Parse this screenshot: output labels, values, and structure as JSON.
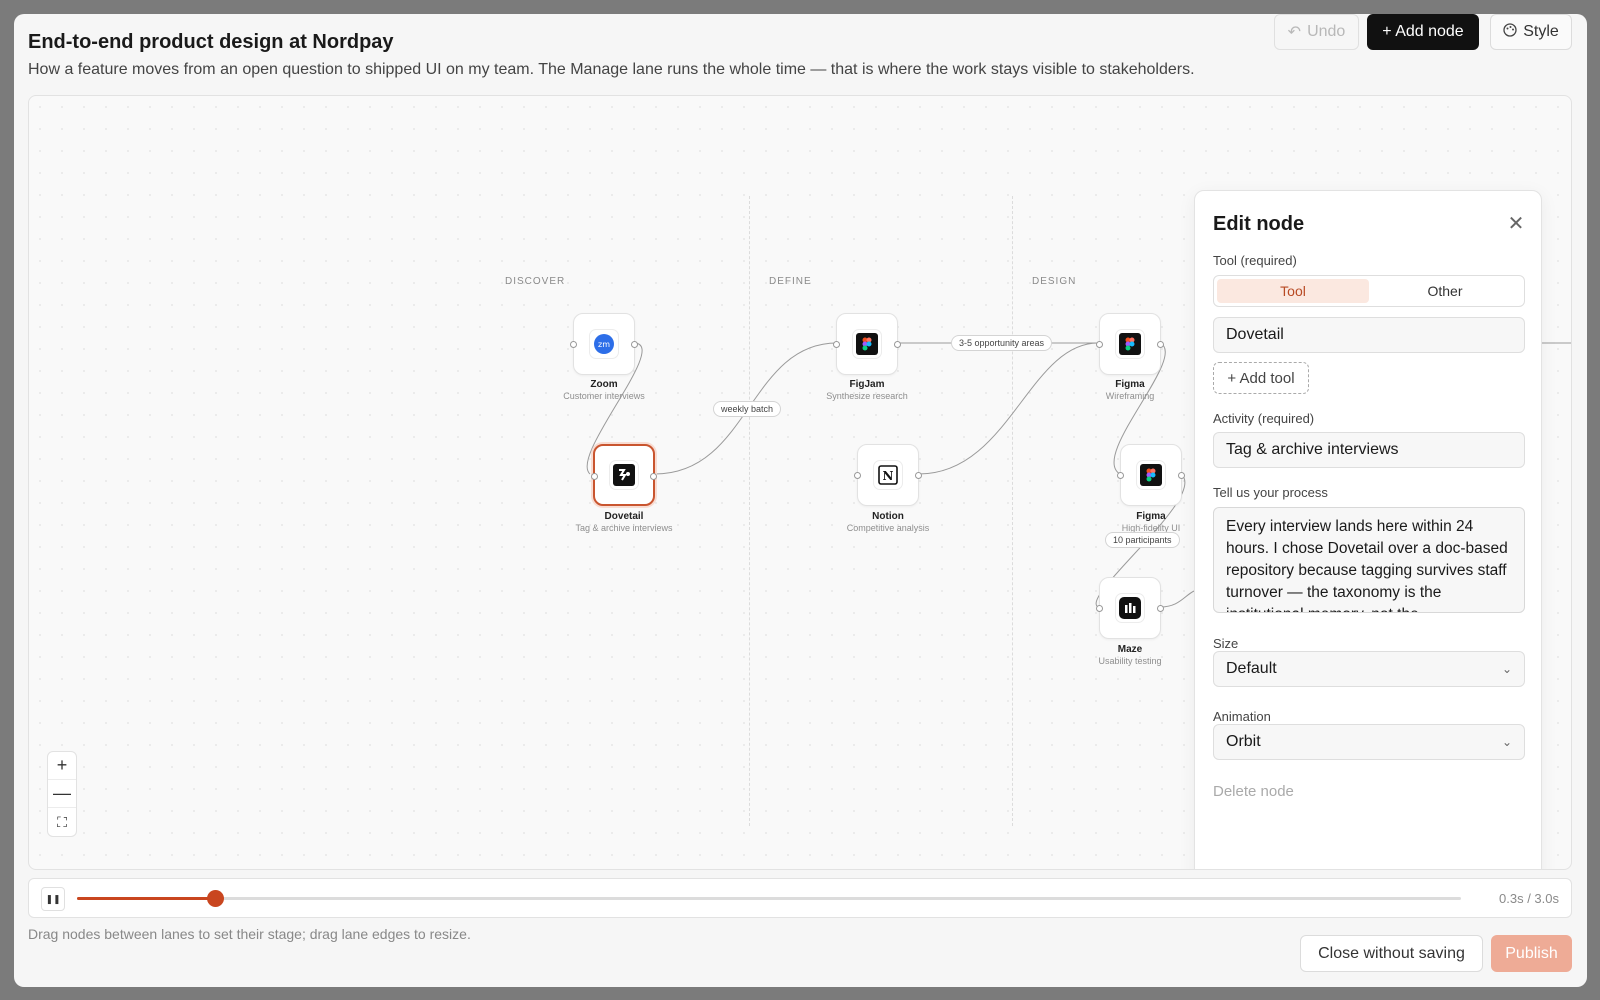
{
  "header": {
    "title": "End-to-end product design at Nordpay",
    "subtitle": "How a feature moves from an open question to shipped UI on my team. The Manage lane runs the whole time — that is where the work stays visible to stakeholders.",
    "undo_label": "Undo",
    "add_node_label": "+ Add node",
    "style_label": "Style"
  },
  "lanes": [
    "DISCOVER",
    "DEFINE",
    "DESIGN"
  ],
  "nodes": [
    {
      "title": "Zoom",
      "subtitle": "Customer interviews",
      "icon": "zoom-icon"
    },
    {
      "title": "Dovetail",
      "subtitle": "Tag & archive interviews",
      "icon": "dovetail-icon",
      "selected": true
    },
    {
      "title": "FigJam",
      "subtitle": "Synthesize research",
      "icon": "figjam-icon"
    },
    {
      "title": "Notion",
      "subtitle": "Competitive analysis",
      "icon": "notion-icon"
    },
    {
      "title": "Figma",
      "subtitle": "Wireframing",
      "icon": "figma-icon"
    },
    {
      "title": "Figma",
      "subtitle": "High-fidelity UI",
      "icon": "figma-icon"
    },
    {
      "title": "Maze",
      "subtitle": "Usability testing",
      "icon": "maze-icon"
    }
  ],
  "edge_labels": [
    "weekly batch",
    "3-5 opportunity areas",
    "10 participants"
  ],
  "zoom_controls": {
    "zoom_in": "+",
    "zoom_out": "—",
    "fit": "⛶"
  },
  "panel": {
    "title": "Edit node",
    "tool_label": "Tool (required)",
    "tool_options": [
      "Tool",
      "Other"
    ],
    "tool_selected": "Tool",
    "tool_value": "Dovetail",
    "add_tool_label": "+ Add tool",
    "activity_label": "Activity (required)",
    "activity_value": "Tag & archive interviews",
    "process_label": "Tell us your process",
    "process_value": "Every interview lands here within 24 hours. I chose Dovetail over a doc-based repository because tagging survives staff turnover — the taxonomy is the institutional memory, not the",
    "size_label": "Size",
    "size_value": "Default",
    "animation_label": "Animation",
    "animation_value": "Orbit",
    "delete_label": "Delete node"
  },
  "timeline": {
    "current": 0.3,
    "total": 3.0,
    "time_label": "0.3s / 3.0s",
    "pause_icon": "pause-icon"
  },
  "footer": {
    "hint": "Drag nodes between lanes to set their stage; drag lane edges to resize.",
    "close_label": "Close without saving",
    "publish_label": "Publish"
  },
  "colors": {
    "accent": "#c9461f",
    "publish_disabled": "#eeab96",
    "primary_button": "#111111"
  }
}
